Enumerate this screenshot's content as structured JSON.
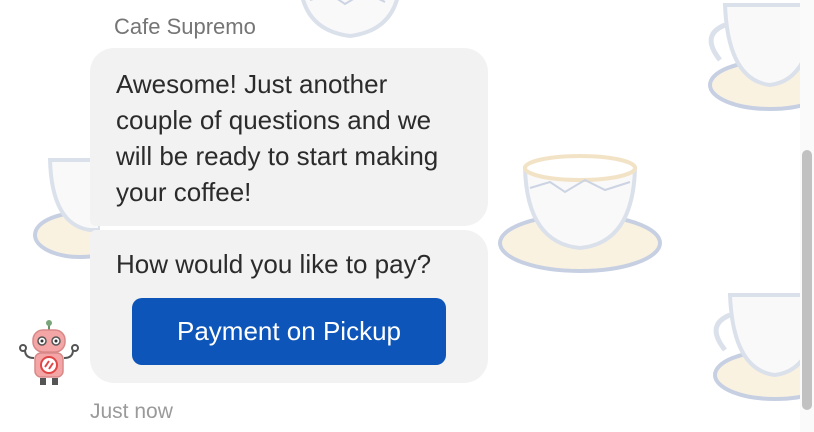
{
  "chat": {
    "sender_name": "Cafe Supremo",
    "message_1": "Awesome! Just another couple of questions and we will be ready to start making your coffee!",
    "message_2": "How would you like to pay?",
    "payment_option": "Payment on Pickup",
    "timestamp": "Just now"
  },
  "icons": {
    "avatar": "robot-avatar-icon",
    "background": "coffee-cup-icon"
  },
  "colors": {
    "button": "#0d55b8",
    "bubble": "#f2f2f2"
  }
}
